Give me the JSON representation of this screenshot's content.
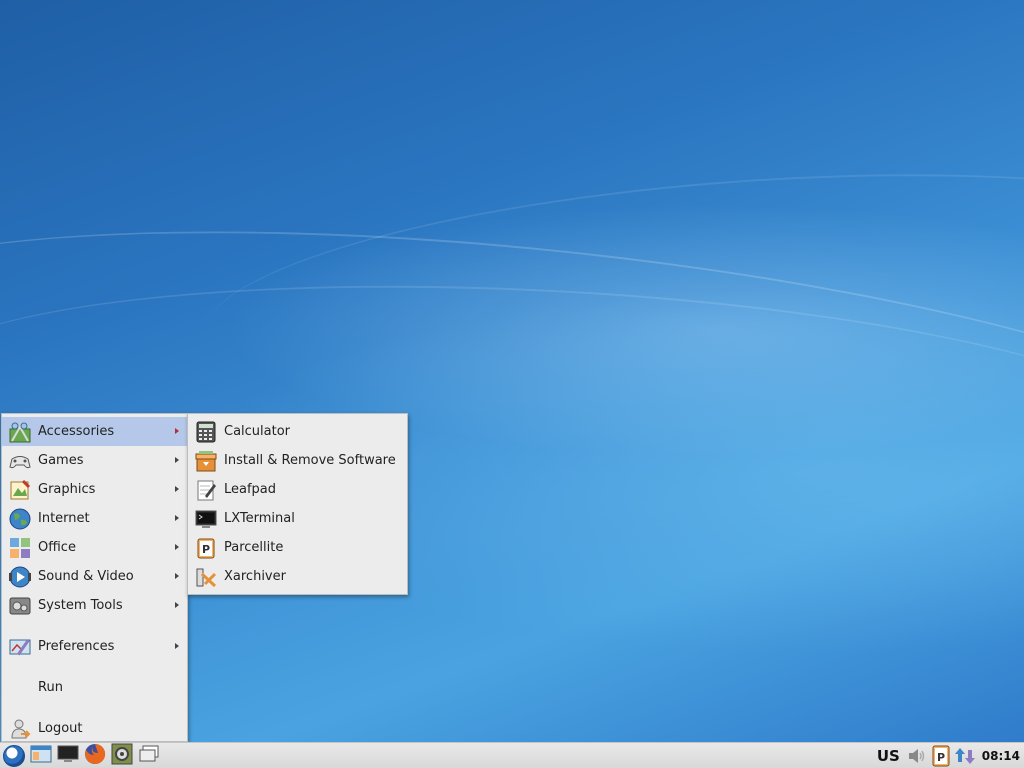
{
  "main_menu": {
    "items": [
      {
        "label": "Accessories",
        "icon": "accessories-icon",
        "submenu": true,
        "active": true
      },
      {
        "label": "Games",
        "icon": "gamepad-icon",
        "submenu": true
      },
      {
        "label": "Graphics",
        "icon": "graphics-icon",
        "submenu": true
      },
      {
        "label": "Internet",
        "icon": "globe-icon",
        "submenu": true
      },
      {
        "label": "Office",
        "icon": "office-icon",
        "submenu": true
      },
      {
        "label": "Sound & Video",
        "icon": "multimedia-icon",
        "submenu": true
      },
      {
        "label": "System Tools",
        "icon": "system-tools-icon",
        "submenu": true
      },
      {
        "label": "Preferences",
        "icon": "preferences-icon",
        "submenu": true
      },
      {
        "label": "Run",
        "icon": "",
        "submenu": false
      },
      {
        "label": "Logout",
        "icon": "logout-icon",
        "submenu": false
      }
    ]
  },
  "accessories_menu": {
    "items": [
      {
        "label": "Calculator",
        "icon": "calculator-icon"
      },
      {
        "label": "Install & Remove Software",
        "icon": "package-icon"
      },
      {
        "label": "Leafpad",
        "icon": "text-editor-icon"
      },
      {
        "label": "LXTerminal",
        "icon": "terminal-icon"
      },
      {
        "label": "Parcellite",
        "icon": "clipboard-icon"
      },
      {
        "label": "Xarchiver",
        "icon": "archive-icon"
      }
    ]
  },
  "taskbar": {
    "launchers": [
      "start-menu-icon",
      "file-manager-icon",
      "terminal-icon",
      "firefox-icon",
      "settings-icon",
      "show-desktop-icon"
    ],
    "keyboard_layout": "US",
    "clock": "08:14",
    "tray_icons": [
      "volume-icon",
      "clipboard-icon",
      "network-icon"
    ]
  },
  "colors": {
    "menu_bg": "#ececec",
    "menu_highlight": "#b5c8ea",
    "taskbar_bg": "#dcdcdc",
    "desktop_blue": "#2f7ccb"
  }
}
